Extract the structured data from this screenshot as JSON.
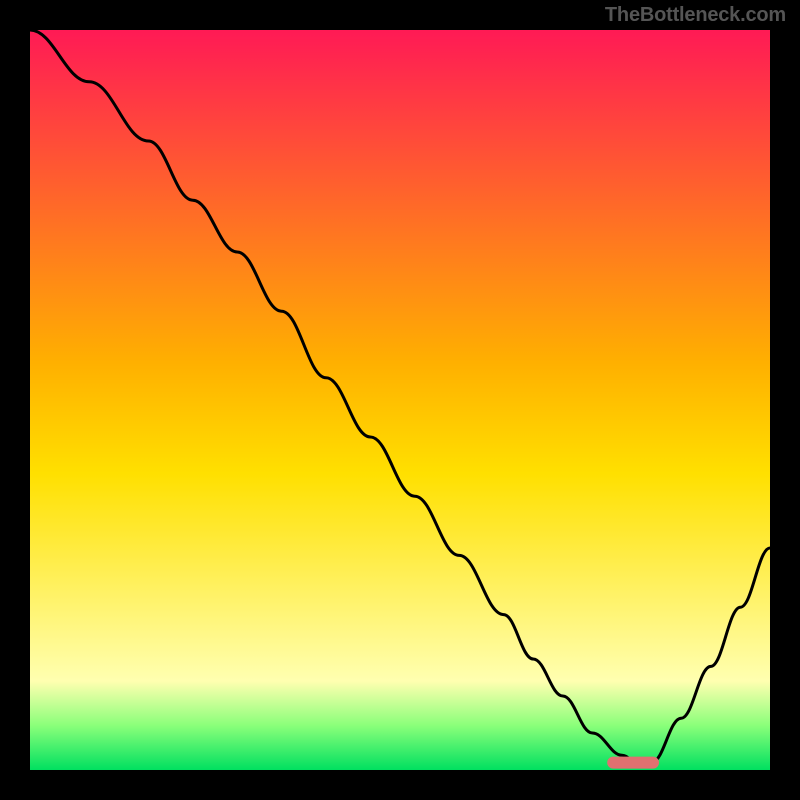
{
  "watermark": "TheBottleneck.com",
  "colors": {
    "top": "#ff1a55",
    "mid": "#ffd400",
    "pale": "#ffffb0",
    "band": "#8aff7a",
    "bottom": "#00e060",
    "curve": "#000000",
    "marker": "#e07070",
    "frame": "#000000"
  },
  "chart_data": {
    "type": "line",
    "title": "",
    "xlabel": "",
    "ylabel": "",
    "xlim": [
      0,
      100
    ],
    "ylim": [
      0,
      100
    ],
    "grid": false,
    "legend": false,
    "annotations": [],
    "series": [
      {
        "name": "curve",
        "x": [
          0,
          8,
          16,
          22,
          28,
          34,
          40,
          46,
          52,
          58,
          64,
          68,
          72,
          76,
          80,
          82,
          84,
          88,
          92,
          96,
          100
        ],
        "values": [
          100,
          93,
          85,
          77,
          70,
          62,
          53,
          45,
          37,
          29,
          21,
          15,
          10,
          5,
          2,
          1,
          1,
          7,
          14,
          22,
          30
        ]
      }
    ],
    "marker": {
      "x_start": 78,
      "x_end": 85,
      "y": 1
    }
  }
}
